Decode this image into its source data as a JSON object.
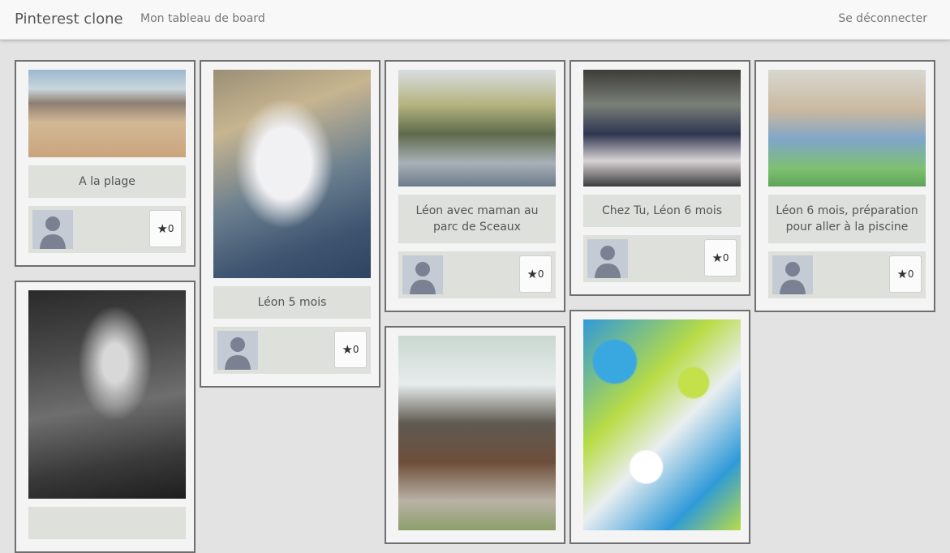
{
  "navbar": {
    "brand": "Pinterest clone",
    "board_link": "Mon tableau de board",
    "logout_link": "Se déconnecter"
  },
  "pins": [
    {
      "caption": "A la plage",
      "stars": "0",
      "star_icon": "★"
    },
    {
      "caption": "Léon 5 mois",
      "stars": "0",
      "star_icon": "★"
    },
    {
      "caption": "Léon avec maman au parc de Sceaux",
      "stars": "0",
      "star_icon": "★"
    },
    {
      "caption": "Chez Tu, Léon 6 mois",
      "stars": "0",
      "star_icon": "★"
    },
    {
      "caption": "Léon 6 mois, préparation pour aller à la piscine",
      "stars": "0",
      "star_icon": "★"
    }
  ],
  "icons": {
    "avatar": "user-silhouette-icon",
    "star": "star-icon"
  }
}
